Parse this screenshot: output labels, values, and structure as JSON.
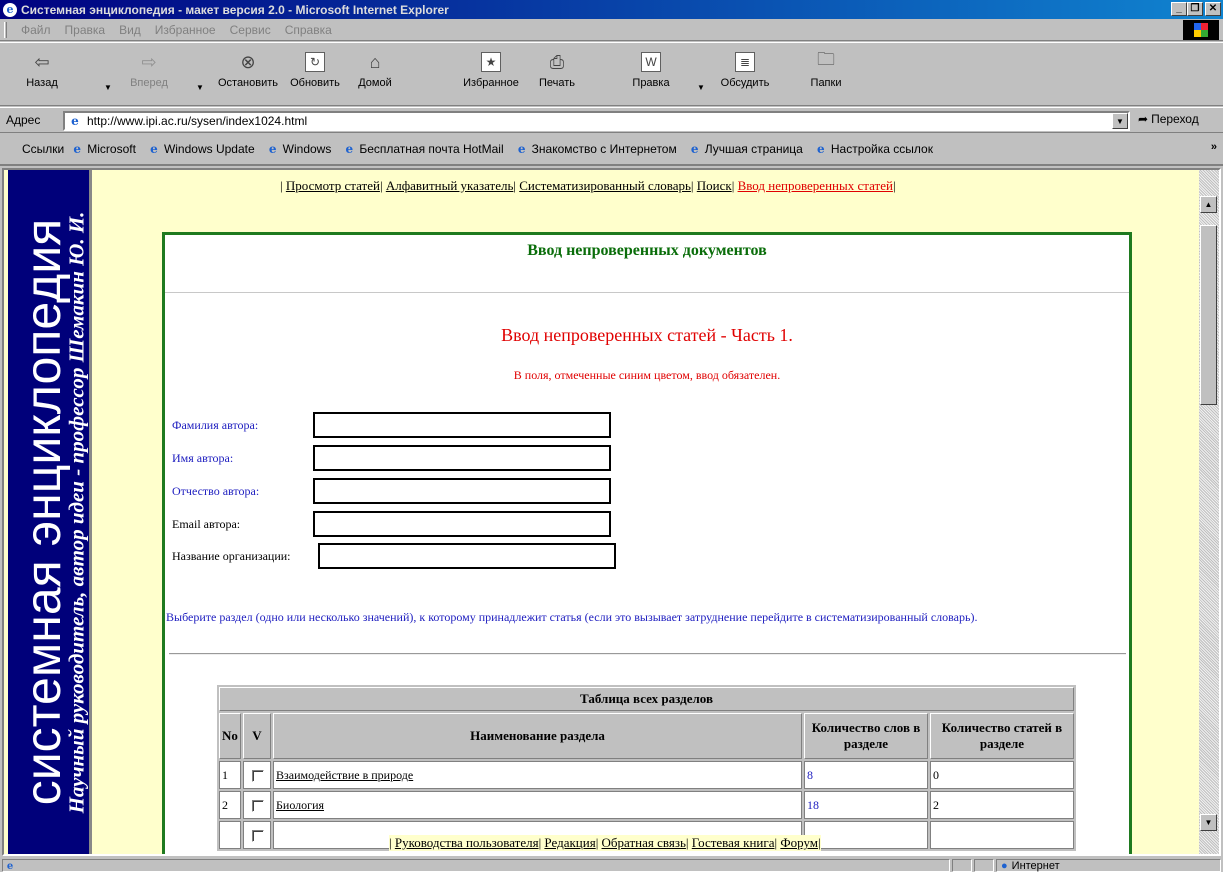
{
  "window": {
    "title": "Системная энциклопедия - макет версия 2.0 - Microsoft Internet Explorer"
  },
  "menu": [
    "Файл",
    "Правка",
    "Вид",
    "Избранное",
    "Сервис",
    "Справка"
  ],
  "toolbar": {
    "back": "Назад",
    "forward": "Вперед",
    "stop": "Остановить",
    "refresh": "Обновить",
    "home": "Домой",
    "favorites": "Избранное",
    "print": "Печать",
    "edit": "Правка",
    "discuss": "Обсудить",
    "folders": "Папки"
  },
  "address": {
    "label": "Адрес",
    "url": "http://www.ipi.ac.ru/sysen/index1024.html",
    "go": "Переход"
  },
  "links": {
    "label": "Ссылки",
    "items": [
      "Microsoft",
      "Windows Update",
      "Windows",
      "Бесплатная почта HotMail",
      "Знакомство с Интернетом",
      "Лучшая страница",
      "Настройка ссылок"
    ],
    "more": "»"
  },
  "sidebar": {
    "title": "системная энциклопедия",
    "subtitle": "Научный руководитель, автор идеи - профессор Шемакин Ю. И."
  },
  "topnav": [
    "Просмотр статей",
    "Алфавитный указатель",
    "Систематизированный словарь",
    "Поиск",
    "Ввод непроверенных статей"
  ],
  "botnav": [
    "Руководства пользователя",
    "Редакция",
    "Обратная связь",
    "Гостевая книга",
    "Форум"
  ],
  "panel": {
    "title": "Ввод непроверенных документов",
    "section_title": "Ввод непроверенных статей - Часть 1.",
    "note": "В поля, отмеченные синим цветом, ввод обязателен.",
    "fields": {
      "lastname": "Фамилия автора:",
      "firstname": "Имя автора:",
      "patronymic": "Отчество автора:",
      "email": "Email автора:",
      "org": "Название организации:"
    },
    "hint": "Выберите раздел (одно или несколько значений), к которому принадлежит статья (если это вызывает затруднение перейдите в систематизированный словарь)."
  },
  "table": {
    "caption": "Таблица всех разделов",
    "headers": {
      "no": "No",
      "v": "V",
      "name": "Наименование раздела",
      "words": "Количество слов в разделе",
      "articles": "Количество статей в разделе"
    },
    "rows": [
      {
        "no": "1",
        "name": "Взаимодействие в природе",
        "words": "8",
        "articles": "0"
      },
      {
        "no": "2",
        "name": "Биология",
        "words": "18",
        "articles": "2"
      }
    ]
  },
  "status": {
    "zone": "Интернет"
  }
}
